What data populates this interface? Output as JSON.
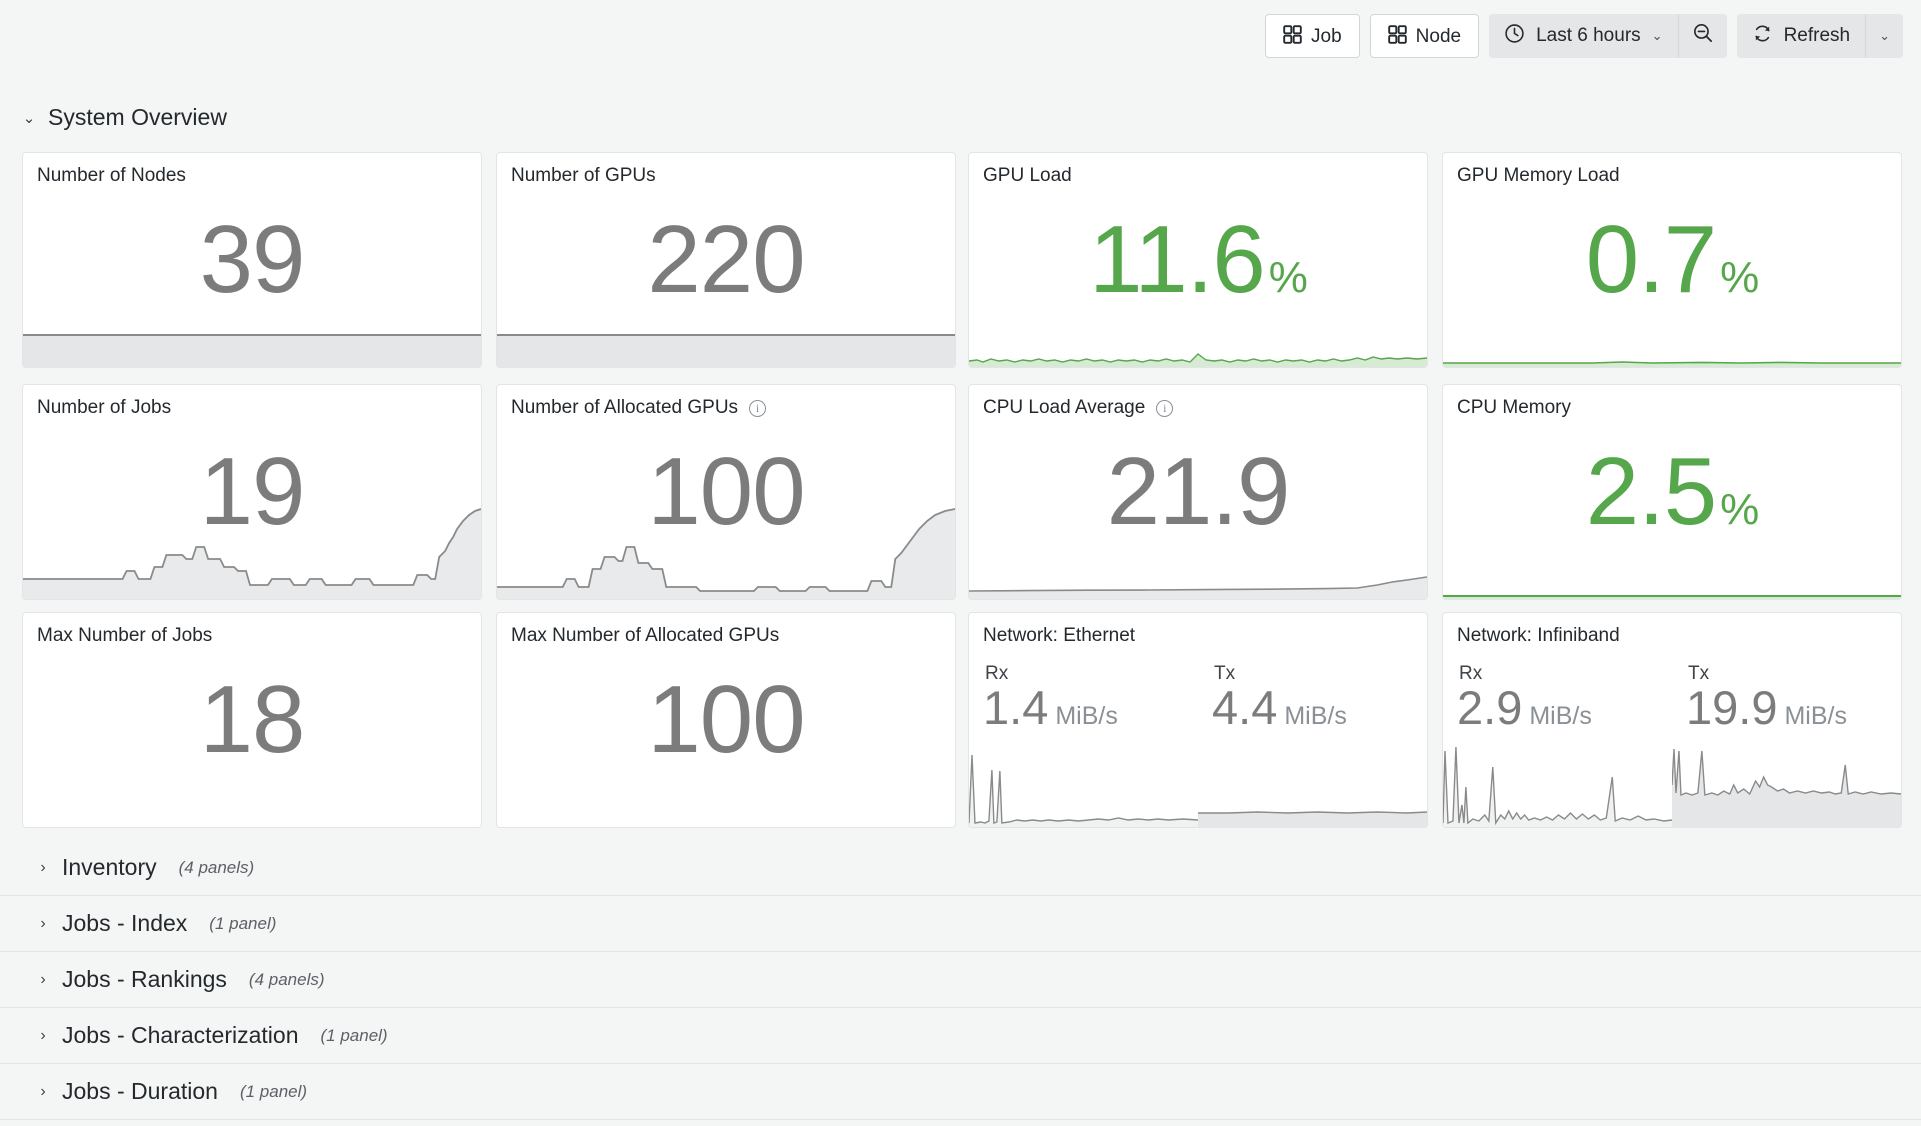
{
  "toolbar": {
    "job_button": "Job",
    "node_button": "Node",
    "time_range": "Last 6 hours",
    "refresh_label": "Refresh",
    "chevron": "⌄",
    "icons": {
      "job": "grid-icon",
      "node": "grid-icon",
      "clock": "clock-icon",
      "zoom_out": "zoom-out-icon",
      "refresh": "refresh-icon"
    }
  },
  "section": {
    "caret": "⌄",
    "title": "System Overview"
  },
  "panels": [
    {
      "title": "Number of Nodes",
      "value": "39",
      "unit": "",
      "color": "#7c7c7c",
      "has_info": false,
      "sparkline": "flat-low"
    },
    {
      "title": "Number of GPUs",
      "value": "220",
      "unit": "",
      "color": "#7c7c7c",
      "has_info": false,
      "sparkline": "flat-low"
    },
    {
      "title": "GPU Load",
      "value": "11.6",
      "unit": "%",
      "color": "#56a64b",
      "has_info": false,
      "sparkline": "noisy-low-green"
    },
    {
      "title": "GPU Memory Load",
      "value": "0.7",
      "unit": "%",
      "color": "#56a64b",
      "has_info": false,
      "sparkline": "flat-green"
    },
    {
      "title": "Number of Jobs",
      "value": "19",
      "unit": "",
      "color": "#7c7c7c",
      "has_info": false,
      "sparkline": "jobs-steps"
    },
    {
      "title": "Number of Allocated GPUs",
      "value": "100",
      "unit": "",
      "color": "#7c7c7c",
      "has_info": true,
      "sparkline": "alloc-steps"
    },
    {
      "title": "CPU Load Average",
      "value": "21.9",
      "unit": "",
      "color": "#7c7c7c",
      "has_info": true,
      "sparkline": "rising-tail"
    },
    {
      "title": "CPU Memory",
      "value": "2.5",
      "unit": "%",
      "color": "#56a64b",
      "has_info": false,
      "sparkline": "flat-green"
    },
    {
      "title": "Max Number of Jobs",
      "value": "18",
      "unit": "",
      "color": "#7c7c7c",
      "has_info": false,
      "sparkline": "none"
    },
    {
      "title": "Max Number of Allocated GPUs",
      "value": "100",
      "unit": "",
      "color": "#7c7c7c",
      "has_info": false,
      "sparkline": "none"
    }
  ],
  "network": [
    {
      "title": "Network: Ethernet",
      "rx_label": "Rx",
      "rx_value": "1.4",
      "rx_unit": "MiB/s",
      "tx_label": "Tx",
      "tx_value": "4.4",
      "tx_unit": "MiB/s"
    },
    {
      "title": "Network: Infiniband",
      "rx_label": "Rx",
      "rx_value": "2.9",
      "rx_unit": "MiB/s",
      "tx_label": "Tx",
      "tx_value": "19.9",
      "tx_unit": "MiB/s"
    }
  ],
  "collapsed_rows": [
    {
      "caret": "›",
      "title": "Inventory",
      "count": "(4 panels)"
    },
    {
      "caret": "›",
      "title": "Jobs - Index",
      "count": "(1 panel)"
    },
    {
      "caret": "›",
      "title": "Jobs - Rankings",
      "count": "(4 panels)"
    },
    {
      "caret": "›",
      "title": "Jobs - Characterization",
      "count": "(1 panel)"
    },
    {
      "caret": "›",
      "title": "Jobs - Duration",
      "count": "(1 panel)"
    }
  ],
  "colors": {
    "accent_green": "#56a64b",
    "stat_gray": "#7c7c7c",
    "panel_bg": "#ffffff",
    "page_bg": "#f4f5f5"
  }
}
